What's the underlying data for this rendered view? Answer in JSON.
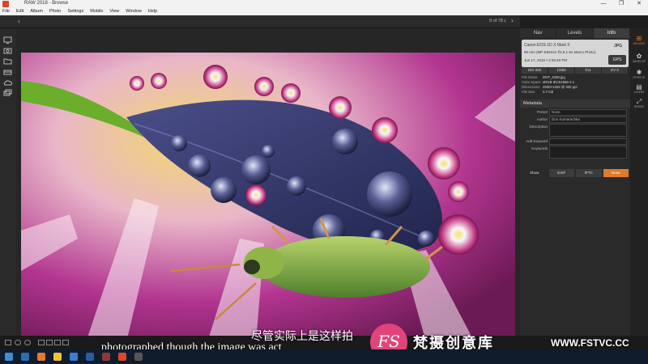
{
  "window": {
    "title": "RAW 2018 - Browse",
    "controls": [
      "—",
      "❐",
      "✕"
    ]
  },
  "menu": [
    "File",
    "Edit",
    "Album",
    "Photo",
    "Settings",
    "Mobile",
    "View",
    "Window",
    "Help"
  ],
  "toolbar": {
    "back_glyph": "‹",
    "image_counter": "9 of 78",
    "prev_glyph": "‹",
    "next_glyph": "›"
  },
  "panel": {
    "tabs": [
      {
        "label": "Nav",
        "active": false
      },
      {
        "label": "Levels",
        "active": false
      },
      {
        "label": "Info",
        "active": true
      }
    ],
    "camera": "Canon EOS-1D X Mark II",
    "lens": "85 mm (MP-E65mm f/2.8 1-5x Macro Photo)",
    "date": "Jun 17, 2016 • 2:36:40 PM",
    "format": "JPG",
    "gps_label": "GPS",
    "exposure": [
      "ISO 250",
      "1/250",
      "f/11",
      "EV 0"
    ],
    "file": [
      {
        "k": "File Name",
        "v": "DKP_4269.jpg"
      },
      {
        "k": "Color Space",
        "v": "sRGB IEC61966-2.1"
      },
      {
        "k": "Dimensions",
        "v": "2500×1328 @ 300 ppi"
      },
      {
        "k": "File Size",
        "v": "0.7 mb"
      }
    ],
    "metadata_title": "Metadata",
    "preset_label": "Preset",
    "preset_value": "None",
    "author_label": "Author",
    "author_value": "Don Komarechka",
    "description_label": "Description",
    "add_keyword_label": "Add Keyword",
    "keywords_label": "Keywords",
    "show_label": "Show",
    "buttons": [
      "EXIF",
      "IPTC",
      "None"
    ]
  },
  "rail": [
    {
      "icon": "browse-icon",
      "glyph": "⊞",
      "label": "BROWSE",
      "active": true
    },
    {
      "icon": "develop-icon",
      "glyph": "✿",
      "label": "DEVELOP",
      "active": false
    },
    {
      "icon": "effects-icon",
      "glyph": "✱",
      "label": "EFFECTS",
      "active": false
    },
    {
      "icon": "layers-icon",
      "glyph": "▤",
      "label": "LAYERS",
      "active": false
    },
    {
      "icon": "resize-icon",
      "glyph": "⤢",
      "label": "RESIZE",
      "active": false
    }
  ],
  "subtitles": {
    "chinese": "尽管实际上是这样拍",
    "english": "photographed though the image was act"
  },
  "watermark": {
    "logo": "FS",
    "site_name": "梵摄创意库",
    "url": "WWW.FSTVC.CC"
  },
  "colors": {
    "accent": "#e07b2b",
    "panel_bg": "#2a2a2a",
    "watermark_pink": "#e0447a"
  }
}
